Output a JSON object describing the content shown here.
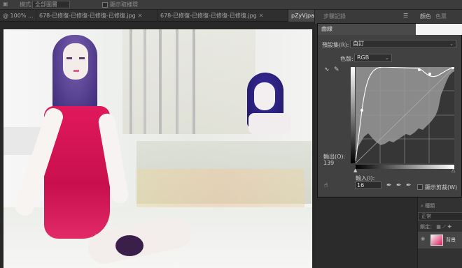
{
  "options_bar": {
    "mode_label": "模式：",
    "mode_value": "全部圖層",
    "checkbox_label": "顯示取樣環"
  },
  "tabs": [
    {
      "label": "@ 100% ...",
      "active": false
    },
    {
      "label": "678-已修復-已修復-已修復-已修復.jpg",
      "active": false
    },
    {
      "label": "678-已修復-已修復-已修復-已修復.jpg",
      "active": false
    },
    {
      "label": "pZyVjpaSlcpi",
      "active": true
    }
  ],
  "right_panel": {
    "history_tab": "步驟記錄",
    "color_tab": "顏色",
    "swatch_tab": "色票"
  },
  "curves_dialog": {
    "title": "曲線",
    "preset_label": "預設集(R):",
    "preset_value": "自訂",
    "channel_label": "色版:",
    "channel_value": "RGB",
    "output_label": "輸出(O):",
    "output_value": "139",
    "input_label": "輸入(I):",
    "input_value": "16",
    "show_clipping_label": "顯示剪裁(W)",
    "curve_points": [
      [
        0,
        0
      ],
      [
        16,
        139
      ],
      [
        255,
        255
      ]
    ]
  },
  "layers_panel": {
    "kind_label": "種類",
    "blend_mode": "正常",
    "lock_label": "鎖定：",
    "layer_name": "背景"
  },
  "colors": {
    "dialog_bg": "#414141",
    "grid_bg": "#8a8a8a",
    "histogram": "#363636",
    "curve": "#ffffff",
    "dress": "#e0185c",
    "hair": "#2a1f6e"
  }
}
